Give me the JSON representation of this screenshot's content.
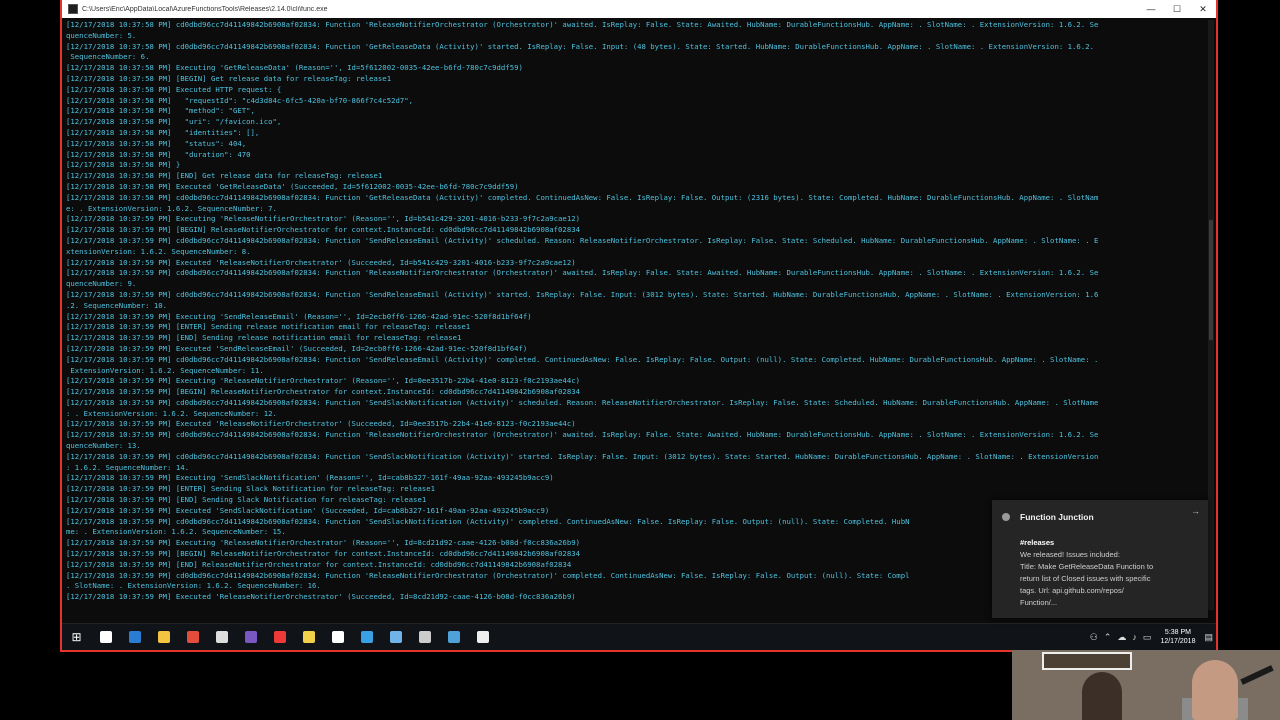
{
  "window": {
    "title": "C:\\Users\\Eric\\AppData\\Local\\AzureFunctionsTools\\Releases\\2.14.0\\cli\\func.exe",
    "controls": [
      "—",
      "☐",
      "✕"
    ]
  },
  "console_lines": [
    {
      "t": "[12/17/2018 10:37:58 PM] cd0dbd96cc7d41149842b6908af02834: Function 'ReleaseNotifierOrchestrator (Orchestrator)' awaited. IsReplay: False. State: Awaited. HubName: DurableFunctionsHub. AppName: . SlotName: . ExtensionVersion: 1.6.2. Se",
      "c": "cy"
    },
    {
      "t": "quenceNumber: 5.",
      "c": "cy"
    },
    {
      "t": "[12/17/2018 10:37:58 PM] cd0dbd96cc7d41149842b6908af02834: Function 'GetReleaseData (Activity)' started. IsReplay: False. Input: (48 bytes). State: Started. HubName: DurableFunctionsHub. AppName: . SlotName: . ExtensionVersion: 1.6.2.",
      "c": "cy"
    },
    {
      "t": " SequenceNumber: 6.",
      "c": "cy"
    },
    {
      "t": "[12/17/2018 10:37:58 PM] Executing 'GetReleaseData' (Reason='', Id=5f612002-0035-42ee-b6fd-780c7c9ddf59)",
      "c": "cy"
    },
    {
      "t": "[12/17/2018 10:37:58 PM] [BEGIN] Get release data for releaseTag: release1",
      "c": "cy"
    },
    {
      "t": "[12/17/2018 10:37:58 PM] Executed HTTP request: {",
      "c": "cy"
    },
    {
      "t": "[12/17/2018 10:37:58 PM]   \"requestId\": \"c4d3d84c-6fc5-420a-bf70-866f7c4c52d7\",",
      "c": "cy"
    },
    {
      "t": "[12/17/2018 10:37:58 PM]   \"method\": \"GET\",",
      "c": "cy"
    },
    {
      "t": "[12/17/2018 10:37:58 PM]   \"uri\": \"/favicon.ico\",",
      "c": "cy"
    },
    {
      "t": "[12/17/2018 10:37:58 PM]   \"identities\": [],",
      "c": "cy"
    },
    {
      "t": "[12/17/2018 10:37:58 PM]   \"status\": 404,",
      "c": "cy"
    },
    {
      "t": "[12/17/2018 10:37:58 PM]   \"duration\": 470",
      "c": "cy"
    },
    {
      "t": "[12/17/2018 10:37:58 PM] }",
      "c": "cy"
    },
    {
      "t": "[12/17/2018 10:37:58 PM] [END] Get release data for releaseTag: release1",
      "c": "cy"
    },
    {
      "t": "[12/17/2018 10:37:58 PM] Executed 'GetReleaseData' (Succeeded, Id=5f612002-0035-42ee-b6fd-780c7c9ddf59)",
      "c": "cy"
    },
    {
      "t": "[12/17/2018 10:37:58 PM] cd0dbd96cc7d41149842b6908af02834: Function 'GetReleaseData (Activity)' completed. ContinuedAsNew: False. IsReplay: False. Output: (2316 bytes). State: Completed. HubName: DurableFunctionsHub. AppName: . SlotNam",
      "c": "cy"
    },
    {
      "t": "e: . ExtensionVersion: 1.6.2. SequenceNumber: 7.",
      "c": "cy"
    },
    {
      "t": "[12/17/2018 10:37:59 PM] Executing 'ReleaseNotifierOrchestrator' (Reason='', Id=b541c429-3201-4016-b233-9f7c2a9cae12)",
      "c": "cy"
    },
    {
      "t": "[12/17/2018 10:37:59 PM] [BEGIN] ReleaseNotifierOrchestrator for context.InstanceId: cd0dbd96cc7d41149842b6908af02834",
      "c": "cy"
    },
    {
      "t": "[12/17/2018 10:37:59 PM] cd0dbd96cc7d41149842b6908af02834: Function 'SendReleaseEmail (Activity)' scheduled. Reason: ReleaseNotifierOrchestrator. IsReplay: False. State: Scheduled. HubName: DurableFunctionsHub. AppName: . SlotName: . E",
      "c": "cy"
    },
    {
      "t": "xtensionVersion: 1.6.2. SequenceNumber: 8.",
      "c": "cy"
    },
    {
      "t": "[12/17/2018 10:37:59 PM] Executed 'ReleaseNotifierOrchestrator' (Succeeded, Id=b541c429-3201-4016-b233-9f7c2a9cae12)",
      "c": "cy"
    },
    {
      "t": "[12/17/2018 10:37:59 PM] cd0dbd96cc7d41149842b6908af02834: Function 'ReleaseNotifierOrchestrator (Orchestrator)' awaited. IsReplay: False. State: Awaited. HubName: DurableFunctionsHub. AppName: . SlotName: . ExtensionVersion: 1.6.2. Se",
      "c": "cy"
    },
    {
      "t": "quenceNumber: 9.",
      "c": "cy"
    },
    {
      "t": "[12/17/2018 10:37:59 PM] cd0dbd96cc7d41149842b6908af02834: Function 'SendReleaseEmail (Activity)' started. IsReplay: False. Input: (3012 bytes). State: Started. HubName: DurableFunctionsHub. AppName: . SlotName: . ExtensionVersion: 1.6",
      "c": "cy"
    },
    {
      "t": ".2. SequenceNumber: 10.",
      "c": "cy"
    },
    {
      "t": "[12/17/2018 10:37:59 PM] Executing 'SendReleaseEmail' (Reason='', Id=2ecb0ff6-1266-42ad-91ec-520f8d1bf64f)",
      "c": "cy"
    },
    {
      "t": "[12/17/2018 10:37:59 PM] [ENTER] Sending release notification email for releaseTag: release1",
      "c": "cy"
    },
    {
      "t": "[12/17/2018 10:37:59 PM] [END] Sending release notification email for releaseTag: release1",
      "c": "cy"
    },
    {
      "t": "[12/17/2018 10:37:59 PM] Executed 'SendReleaseEmail' (Succeeded, Id=2ecb0ff6-1266-42ad-91ec-520f8d1bf64f)",
      "c": "cy"
    },
    {
      "t": "[12/17/2018 10:37:59 PM] cd0dbd96cc7d41149842b6908af02834: Function 'SendReleaseEmail (Activity)' completed. ContinuedAsNew: False. IsReplay: False. Output: (null). State: Completed. HubName: DurableFunctionsHub. AppName: . SlotName: .",
      "c": "cy"
    },
    {
      "t": " ExtensionVersion: 1.6.2. SequenceNumber: 11.",
      "c": "cy"
    },
    {
      "t": "[12/17/2018 10:37:59 PM] Executing 'ReleaseNotifierOrchestrator' (Reason='', Id=0ee3517b-22b4-41e0-8123-f0c2193ae44c)",
      "c": "cy"
    },
    {
      "t": "[12/17/2018 10:37:59 PM] [BEGIN] ReleaseNotifierOrchestrator for context.InstanceId: cd0dbd96cc7d41149842b6908af02834",
      "c": "cy"
    },
    {
      "t": "[12/17/2018 10:37:59 PM] cd0dbd96cc7d41149842b6908af02834: Function 'SendSlackNotification (Activity)' scheduled. Reason: ReleaseNotifierOrchestrator. IsReplay: False. State: Scheduled. HubName: DurableFunctionsHub. AppName: . SlotName",
      "c": "cy"
    },
    {
      "t": ": . ExtensionVersion: 1.6.2. SequenceNumber: 12.",
      "c": "cy"
    },
    {
      "t": "[12/17/2018 10:37:59 PM] Executed 'ReleaseNotifierOrchestrator' (Succeeded, Id=0ee3517b-22b4-41e0-8123-f0c2193ae44c)",
      "c": "cy"
    },
    {
      "t": "[12/17/2018 10:37:59 PM] cd0dbd96cc7d41149842b6908af02834: Function 'ReleaseNotifierOrchestrator (Orchestrator)' awaited. IsReplay: False. State: Awaited. HubName: DurableFunctionsHub. AppName: . SlotName: . ExtensionVersion: 1.6.2. Se",
      "c": "cy"
    },
    {
      "t": "quenceNumber: 13.",
      "c": "cy"
    },
    {
      "t": "[12/17/2018 10:37:59 PM] cd0dbd96cc7d41149842b6908af02834: Function 'SendSlackNotification (Activity)' started. IsReplay: False. Input: (3012 bytes). State: Started. HubName: DurableFunctionsHub. AppName: . SlotName: . ExtensionVersion",
      "c": "cy"
    },
    {
      "t": ": 1.6.2. SequenceNumber: 14.",
      "c": "cy"
    },
    {
      "t": "[12/17/2018 10:37:59 PM] Executing 'SendSlackNotification' (Reason='', Id=cab8b327-161f-49aa-92aa-493245b9acc9)",
      "c": "cy"
    },
    {
      "t": "[12/17/2018 10:37:59 PM] [ENTER] Sending Slack Notification for releaseTag: release1",
      "c": "cy"
    },
    {
      "t": "[12/17/2018 10:37:59 PM] [END] Sending Slack Notification for releaseTag: release1",
      "c": "cy"
    },
    {
      "t": "[12/17/2018 10:37:59 PM] Executed 'SendSlackNotification' (Succeeded, Id=cab8b327-161f-49aa-92aa-493245b9acc9)",
      "c": "cy"
    },
    {
      "t": "[12/17/2018 10:37:59 PM] cd0dbd96cc7d41149842b6908af02834: Function 'SendSlackNotification (Activity)' completed. ContinuedAsNew: False. IsReplay: False. Output: (null). State: Completed. HubN",
      "c": "cy"
    },
    {
      "t": "me: . ExtensionVersion: 1.6.2. SequenceNumber: 15.",
      "c": "cy"
    },
    {
      "t": "[12/17/2018 10:37:59 PM] Executing 'ReleaseNotifierOrchestrator' (Reason='', Id=8cd21d92-caae-4126-b08d-f0cc836a26b9)",
      "c": "cy"
    },
    {
      "t": "[12/17/2018 10:37:59 PM] [BEGIN] ReleaseNotifierOrchestrator for context.InstanceId: cd0dbd96cc7d41149842b6908af02834",
      "c": "cy"
    },
    {
      "t": "[12/17/2018 10:37:59 PM] [END] ReleaseNotifierOrchestrator for context.InstanceId: cd0dbd96cc7d41149842b6908af02834",
      "c": "cy"
    },
    {
      "t": "[12/17/2018 10:37:59 PM] cd0dbd96cc7d41149842b6908af02834: Function 'ReleaseNotifierOrchestrator (Orchestrator)' completed. ContinuedAsNew: False. IsReplay: False. Output: (null). State: Compl",
      "c": "cy"
    },
    {
      "t": ". SlotName: . ExtensionVersion: 1.6.2. SequenceNumber: 16.",
      "c": "cy"
    },
    {
      "t": "[12/17/2018 10:37:59 PM] Executed 'ReleaseNotifierOrchestrator' (Succeeded, Id=8cd21d92-caae-4126-b08d-f0cc836a26b9)",
      "c": "cy"
    }
  ],
  "toast": {
    "app_name": "Function Junction",
    "channel": "#releases",
    "message": "We released! Issues included:\nTitle: Make GetReleaseData Function to\nreturn list of Closed issues with specific\ntags. Url: api.github.com/repos/\nFunction/...",
    "expand_glyph": "→"
  },
  "taskbar": {
    "start_glyph": "⊞",
    "apps": [
      {
        "name": "cortana-icon",
        "color": "#ffffff"
      },
      {
        "name": "edge-icon",
        "color": "#2b7cd3"
      },
      {
        "name": "file-explorer-icon",
        "color": "#f3c342"
      },
      {
        "name": "chrome-icon",
        "color": "#e44c3c"
      },
      {
        "name": "mail-icon",
        "color": "#dddddd"
      },
      {
        "name": "visual-studio-icon",
        "color": "#7a58c2"
      },
      {
        "name": "vivaldi-icon",
        "color": "#ef3939"
      },
      {
        "name": "app-icon",
        "color": "#f1d04a"
      },
      {
        "name": "slack-icon",
        "color": "#ffffff"
      },
      {
        "name": "chrome-canary-icon",
        "color": "#3aa0e6"
      },
      {
        "name": "app-blue-icon",
        "color": "#6fb3e8"
      },
      {
        "name": "terminal-icon",
        "color": "#cccccc"
      },
      {
        "name": "app-dark-icon",
        "color": "#4ea1d9"
      },
      {
        "name": "app-white-icon",
        "color": "#eeeeee"
      }
    ],
    "time": "5:38 PM",
    "date": "12/17/2018"
  }
}
